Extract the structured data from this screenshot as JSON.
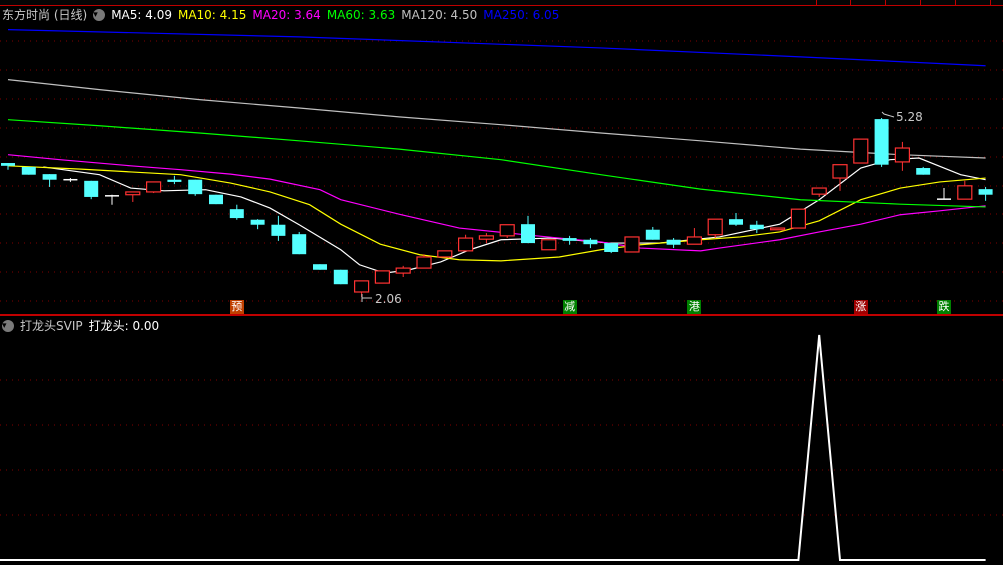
{
  "header": {
    "title": "东方时尚 (日线)",
    "ma": [
      {
        "label": "MA5: 4.09",
        "color": "#ffffff"
      },
      {
        "label": "MA10: 4.15",
        "color": "#ffff00"
      },
      {
        "label": "MA20: 3.64",
        "color": "#ff00ff"
      },
      {
        "label": "MA60: 3.63",
        "color": "#00ff00"
      },
      {
        "label": "MA120: 4.50",
        "color": "#c0c0c0"
      },
      {
        "label": "MA250: 6.05",
        "color": "#0000ff"
      }
    ]
  },
  "indicator_header": {
    "name": "打龙头SVIP",
    "value_label": "打龙头: 0.00"
  },
  "annotations": {
    "high_label": "5.28",
    "low_label": "2.06"
  },
  "signals": [
    {
      "text": "预",
      "candle": 11,
      "color": "#c04000"
    },
    {
      "text": "减",
      "candle": 27,
      "color": "#008000"
    },
    {
      "text": "港",
      "candle": 33,
      "color": "#008000"
    },
    {
      "text": "涨",
      "candle": 41,
      "color": "#a00000"
    },
    {
      "text": "跌",
      "candle": 45,
      "color": "#008000"
    }
  ],
  "colors": {
    "up": "#ff3232",
    "down": "#54ffff",
    "doji": "#ffffff",
    "grid": "#800000",
    "separator": "#c00000"
  },
  "chart_data": [
    {
      "type": "candlestick",
      "title": "东方时尚 (日线)",
      "ylim": [
        2.06,
        5.28
      ],
      "ohlc": [
        [
          4.47,
          4.47,
          4.35,
          4.42
        ],
        [
          4.4,
          4.4,
          4.26,
          4.26
        ],
        [
          4.27,
          4.27,
          4.04,
          4.17
        ],
        [
          4.17,
          4.2,
          4.13,
          4.17
        ],
        [
          4.15,
          4.15,
          3.82,
          3.86
        ],
        [
          3.88,
          3.9,
          3.72,
          3.88
        ],
        [
          3.9,
          3.95,
          3.77,
          3.95
        ],
        [
          3.95,
          4.13,
          3.93,
          4.13
        ],
        [
          4.17,
          4.24,
          4.09,
          4.13
        ],
        [
          4.17,
          4.17,
          3.88,
          3.91
        ],
        [
          3.9,
          3.9,
          3.73,
          3.73
        ],
        [
          3.64,
          3.72,
          3.45,
          3.48
        ],
        [
          3.45,
          3.46,
          3.28,
          3.36
        ],
        [
          3.36,
          3.52,
          3.07,
          3.16
        ],
        [
          3.19,
          3.23,
          2.83,
          2.83
        ],
        [
          2.65,
          2.65,
          2.55,
          2.55
        ],
        [
          2.55,
          2.55,
          2.29,
          2.29
        ],
        [
          2.15,
          2.35,
          2.06,
          2.35
        ],
        [
          2.31,
          2.53,
          2.31,
          2.53
        ],
        [
          2.49,
          2.62,
          2.42,
          2.58
        ],
        [
          2.58,
          2.83,
          2.58,
          2.78
        ],
        [
          2.78,
          2.89,
          2.78,
          2.89
        ],
        [
          2.89,
          3.18,
          2.89,
          3.12
        ],
        [
          3.1,
          3.21,
          3.03,
          3.16
        ],
        [
          3.16,
          3.36,
          3.12,
          3.36
        ],
        [
          3.37,
          3.52,
          3.03,
          3.03
        ],
        [
          2.91,
          3.09,
          2.91,
          3.09
        ],
        [
          3.12,
          3.16,
          3.0,
          3.07
        ],
        [
          3.09,
          3.12,
          2.94,
          3.01
        ],
        [
          3.03,
          3.03,
          2.85,
          2.87
        ],
        [
          2.87,
          3.14,
          2.87,
          3.14
        ],
        [
          3.27,
          3.32,
          3.09,
          3.09
        ],
        [
          3.09,
          3.12,
          2.94,
          3.0
        ],
        [
          3.01,
          3.3,
          3.01,
          3.14
        ],
        [
          3.18,
          3.46,
          3.12,
          3.46
        ],
        [
          3.46,
          3.57,
          3.34,
          3.36
        ],
        [
          3.36,
          3.43,
          3.21,
          3.28
        ],
        [
          3.27,
          3.3,
          3.27,
          3.3
        ],
        [
          3.3,
          3.64,
          3.3,
          3.64
        ],
        [
          3.91,
          4.02,
          3.86,
          4.02
        ],
        [
          4.2,
          4.44,
          3.97,
          4.44
        ],
        [
          4.47,
          4.9,
          4.47,
          4.9
        ],
        [
          5.26,
          5.28,
          4.4,
          4.44
        ],
        [
          4.49,
          4.85,
          4.33,
          4.74
        ],
        [
          4.38,
          4.4,
          4.26,
          4.26
        ],
        [
          3.82,
          4.02,
          3.82,
          3.82
        ],
        [
          3.82,
          4.15,
          3.82,
          4.06
        ],
        [
          4.0,
          4.04,
          3.79,
          3.9
        ]
      ],
      "ma_lines": [
        {
          "name": "MA5",
          "color": "#ffffff",
          "points": [
            [
              1.7,
              4.4
            ],
            [
              4.4,
              4.26
            ],
            [
              5.9,
              4.02
            ],
            [
              7.5,
              3.97
            ],
            [
              9.5,
              3.99
            ],
            [
              11.2,
              3.86
            ],
            [
              12.6,
              3.66
            ],
            [
              14,
              3.36
            ],
            [
              16,
              2.91
            ],
            [
              16.9,
              2.64
            ],
            [
              18.1,
              2.49
            ],
            [
              19.3,
              2.55
            ],
            [
              20.8,
              2.69
            ],
            [
              22.2,
              2.91
            ],
            [
              23.7,
              3.09
            ],
            [
              26.1,
              3.12
            ],
            [
              28.9,
              3.03
            ],
            [
              31.3,
              3.03
            ],
            [
              34.2,
              3.14
            ],
            [
              37.1,
              3.37
            ],
            [
              39,
              3.81
            ],
            [
              41,
              4.38
            ],
            [
              42.4,
              4.53
            ],
            [
              43.8,
              4.56
            ],
            [
              45.8,
              4.26
            ],
            [
              47,
              4.17
            ]
          ]
        },
        {
          "name": "MA10",
          "color": "#ffff00",
          "points": [
            [
              0,
              4.42
            ],
            [
              3.5,
              4.36
            ],
            [
              5.9,
              4.31
            ],
            [
              8.3,
              4.26
            ],
            [
              10.7,
              4.11
            ],
            [
              12.6,
              3.95
            ],
            [
              14.5,
              3.72
            ],
            [
              16,
              3.37
            ],
            [
              17.9,
              3.01
            ],
            [
              19.8,
              2.82
            ],
            [
              21.7,
              2.73
            ],
            [
              23.7,
              2.71
            ],
            [
              26.5,
              2.78
            ],
            [
              28.5,
              2.91
            ],
            [
              30.4,
              3.0
            ],
            [
              33.3,
              3.09
            ],
            [
              35.2,
              3.14
            ],
            [
              37.1,
              3.23
            ],
            [
              39,
              3.43
            ],
            [
              41,
              3.81
            ],
            [
              42.9,
              4.02
            ],
            [
              44.8,
              4.13
            ],
            [
              47,
              4.2
            ]
          ]
        },
        {
          "name": "MA20",
          "color": "#ff00ff",
          "points": [
            [
              0,
              4.62
            ],
            [
              2.5,
              4.53
            ],
            [
              5.9,
              4.42
            ],
            [
              8.3,
              4.35
            ],
            [
              10.7,
              4.27
            ],
            [
              12.6,
              4.18
            ],
            [
              15,
              3.99
            ],
            [
              16,
              3.81
            ],
            [
              18.8,
              3.55
            ],
            [
              21.7,
              3.3
            ],
            [
              24.6,
              3.19
            ],
            [
              26.5,
              3.12
            ],
            [
              28.5,
              3.05
            ],
            [
              30.4,
              2.94
            ],
            [
              33.3,
              2.89
            ],
            [
              34.2,
              2.94
            ],
            [
              37.1,
              3.09
            ],
            [
              39,
              3.23
            ],
            [
              41,
              3.37
            ],
            [
              42.9,
              3.54
            ],
            [
              44.8,
              3.61
            ],
            [
              47,
              3.7
            ]
          ]
        },
        {
          "name": "MA60",
          "color": "#00ff00",
          "points": [
            [
              0,
              5.25
            ],
            [
              4.4,
              5.14
            ],
            [
              9.2,
              5.01
            ],
            [
              14,
              4.87
            ],
            [
              18.8,
              4.72
            ],
            [
              23.7,
              4.53
            ],
            [
              28.5,
              4.26
            ],
            [
              33.3,
              4.0
            ],
            [
              38.1,
              3.81
            ],
            [
              42.9,
              3.73
            ],
            [
              47,
              3.68
            ]
          ]
        },
        {
          "name": "MA120",
          "color": "#c0c0c0",
          "points": [
            [
              0,
              5.97
            ],
            [
              4.4,
              5.79
            ],
            [
              9.2,
              5.61
            ],
            [
              14,
              5.46
            ],
            [
              18.8,
              5.3
            ],
            [
              23.7,
              5.16
            ],
            [
              28.5,
              5.01
            ],
            [
              33.3,
              4.87
            ],
            [
              38.1,
              4.72
            ],
            [
              42.9,
              4.62
            ],
            [
              47,
              4.56
            ]
          ]
        },
        {
          "name": "MA250",
          "color": "#0000ff",
          "points": [
            [
              0,
              6.87
            ],
            [
              14,
              6.74
            ],
            [
              28.5,
              6.54
            ],
            [
              38.1,
              6.38
            ],
            [
              47,
              6.22
            ]
          ]
        }
      ]
    },
    {
      "type": "line",
      "title": "打龙头SVIP",
      "ylim": [
        0,
        1
      ],
      "series": [
        {
          "name": "打龙头",
          "color": "#ffffff",
          "points": [
            [
              0,
              0
            ],
            [
              38,
              0
            ],
            [
              39,
              1
            ],
            [
              40,
              0
            ],
            [
              47,
              0
            ]
          ]
        }
      ]
    }
  ]
}
